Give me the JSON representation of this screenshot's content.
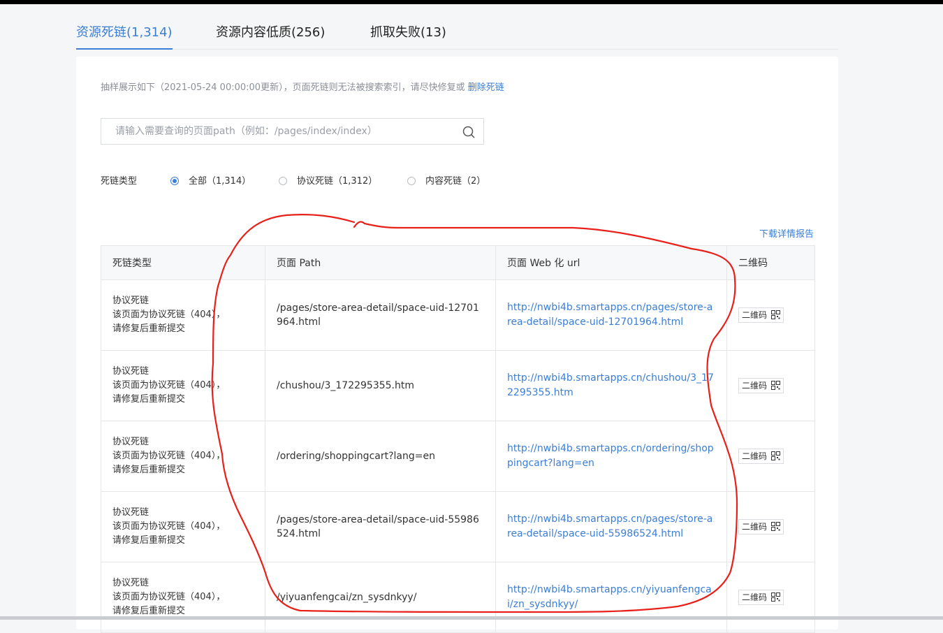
{
  "tabs": [
    {
      "label": "资源死链(1,314)",
      "active": true
    },
    {
      "label": "资源内容低质(256)",
      "active": false
    },
    {
      "label": "抓取失败(13)",
      "active": false
    }
  ],
  "notice": {
    "text": "抽样展示如下（2021-05-24 00:00:00更新），页面死链则无法被搜索索引，请尽快修复或 ",
    "link": "删除死链"
  },
  "search": {
    "placeholder": "请输入需要查询的页面path（例如：/pages/index/index）",
    "icon": "search-icon"
  },
  "filter": {
    "label": "死链类型",
    "options": [
      {
        "label": "全部（1,314）",
        "checked": true
      },
      {
        "label": "协议死链（1,312）",
        "checked": false
      },
      {
        "label": "内容死链（2）",
        "checked": false
      }
    ]
  },
  "download_label": "下载详情报告",
  "table": {
    "headers": [
      "死链类型",
      "页面 Path",
      "页面 Web 化 url",
      "二维码"
    ],
    "rows": [
      {
        "type": "协议死链",
        "desc": "该页面为协议死链（404），",
        "hint": "请修复后重新提交",
        "path": "/pages/store-area-detail/space-uid-12701964.html",
        "url": "http://nwbi4b.smartapps.cn/pages/store-area-detail/space-uid-12701964.html",
        "qr": "二维码"
      },
      {
        "type": "协议死链",
        "desc": "该页面为协议死链（404），",
        "hint": "请修复后重新提交",
        "path": "/chushou/3_172295355.htm",
        "url": "http://nwbi4b.smartapps.cn/chushou/3_172295355.htm",
        "qr": "二维码"
      },
      {
        "type": "协议死链",
        "desc": "该页面为协议死链（404），",
        "hint": "请修复后重新提交",
        "path": "/ordering/shoppingcart?lang=en",
        "url": "http://nwbi4b.smartapps.cn/ordering/shoppingcart?lang=en",
        "qr": "二维码"
      },
      {
        "type": "协议死链",
        "desc": "该页面为协议死链（404），",
        "hint": "请修复后重新提交",
        "path": "/pages/store-area-detail/space-uid-55986524.html",
        "url": "http://nwbi4b.smartapps.cn/pages/store-area-detail/space-uid-55986524.html",
        "qr": "二维码"
      },
      {
        "type": "协议死链",
        "desc": "该页面为协议死链（404），",
        "hint": "请修复后重新提交",
        "path": "/yiyuanfengcai/zn_sysdnkyy/",
        "url": "http://nwbi4b.smartapps.cn/yiyuanfengcai/zn_sysdnkyy/",
        "qr": "二维码"
      }
    ]
  },
  "colors": {
    "accent": "#3a7ed8",
    "annotation": "#e8201a"
  }
}
